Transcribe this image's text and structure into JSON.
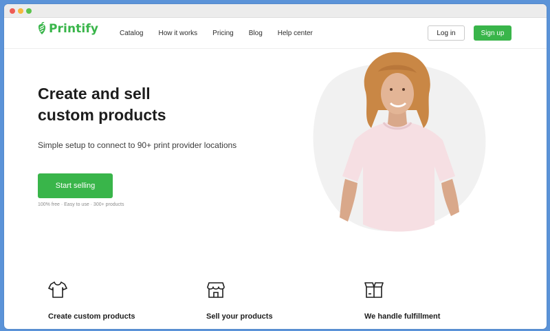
{
  "brand": {
    "name": "Printify",
    "color": "#39b54a"
  },
  "nav": {
    "links": [
      "Catalog",
      "How it works",
      "Pricing",
      "Blog",
      "Help center"
    ],
    "login_label": "Log in",
    "signup_label": "Sign up"
  },
  "hero": {
    "title_line1": "Create and sell",
    "title_line2": "custom products",
    "subtitle": "Simple setup to connect to 90+ print provider locations",
    "cta_label": "Start selling",
    "note": "100% free · Easy to use · 300+ products"
  },
  "features": [
    {
      "icon": "tshirt-icon",
      "title": "Create custom products"
    },
    {
      "icon": "storefront-icon",
      "title": "Sell your products"
    },
    {
      "icon": "package-icon",
      "title": "We handle fulfillment"
    }
  ]
}
